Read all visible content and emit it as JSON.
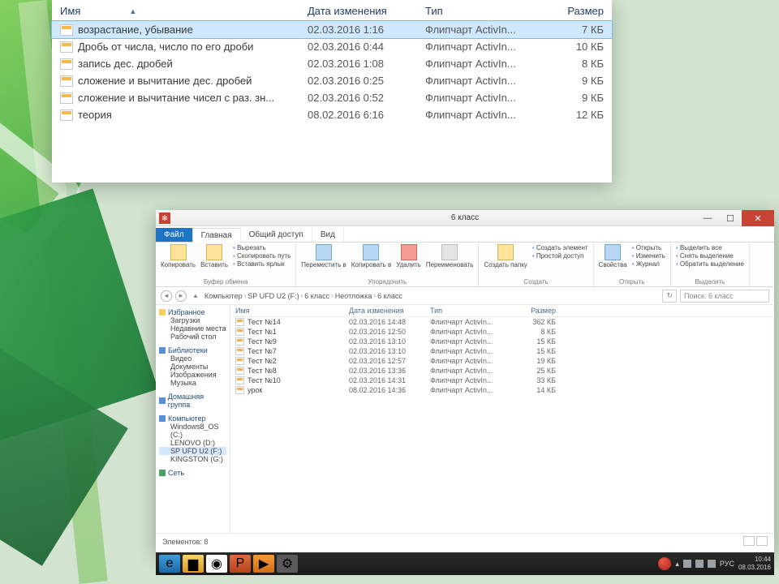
{
  "panel1": {
    "headers": {
      "name": "Имя",
      "date": "Дата изменения",
      "type": "Тип",
      "size": "Размер"
    },
    "rows": [
      {
        "name": "возрастание, убывание",
        "date": "02.03.2016 1:16",
        "type": "Флипчарт ActivIn...",
        "size": "7 КБ",
        "selected": true
      },
      {
        "name": "Дробь от числа, число по его дроби",
        "date": "02.03.2016 0:44",
        "type": "Флипчарт ActivIn...",
        "size": "10 КБ"
      },
      {
        "name": "запись дес. дробей",
        "date": "02.03.2016 1:08",
        "type": "Флипчарт ActivIn...",
        "size": "8 КБ"
      },
      {
        "name": "сложение и вычитание дес. дробей",
        "date": "02.03.2016 0:25",
        "type": "Флипчарт ActivIn...",
        "size": "9 КБ"
      },
      {
        "name": "сложение и вычитание чисел с раз. зн...",
        "date": "02.03.2016 0:52",
        "type": "Флипчарт ActivIn...",
        "size": "9 КБ"
      },
      {
        "name": "теория",
        "date": "08.02.2016 6:16",
        "type": "Флипчарт ActivIn...",
        "size": "12 КБ"
      }
    ]
  },
  "win": {
    "title": "6 класс",
    "tabs": {
      "file": "Файл",
      "home": "Главная",
      "share": "Общий доступ",
      "view": "Вид"
    },
    "ribbon": {
      "g1_big1": "Копировать",
      "g1_big2": "Вставить",
      "g1_s1": "Вырезать",
      "g1_s2": "Скопировать путь",
      "g1_s3": "Вставить ярлык",
      "g1_lab": "Буфер обмена",
      "g2_b1": "Переместить в",
      "g2_b2": "Копировать в",
      "g2_b3": "Удалить",
      "g2_b4": "Переименовать",
      "g2_lab": "Упорядочить",
      "g3_b1": "Создать папку",
      "g3_s1": "Создать элемент",
      "g3_s2": "Простой доступ",
      "g3_lab": "Создать",
      "g4_b1": "Свойства",
      "g4_s1": "Открыть",
      "g4_s2": "Изменить",
      "g4_s3": "Журнал",
      "g4_lab": "Открыть",
      "g5_s1": "Выделить все",
      "g5_s2": "Снять выделение",
      "g5_s3": "Обратить выделение",
      "g5_lab": "Выделить"
    },
    "breadcrumb": [
      "Компьютер",
      "SP UFD U2 (F:)",
      "6 класс",
      "Неотложка",
      "6 класс"
    ],
    "refresh": "↻",
    "search_placeholder": "Поиск: 6 класс",
    "tree": {
      "fav": "Избранное",
      "fav_items": [
        "Загрузки",
        "Недавние места",
        "Рабочий стол"
      ],
      "lib": "Библиотеки",
      "lib_items": [
        "Видео",
        "Документы",
        "Изображения",
        "Музыка"
      ],
      "home": "Домашняя группа",
      "comp": "Компьютер",
      "comp_items": [
        "Windows8_OS (C:)",
        "LENOVO (D:)",
        "SP UFD U2 (F:)",
        "KINGSTON (G:)"
      ],
      "net": "Сеть",
      "selected": "SP UFD U2 (F:)"
    },
    "fheaders": {
      "name": "Имя",
      "date": "Дата изменения",
      "type": "Тип",
      "size": "Размер"
    },
    "files": [
      {
        "n": "Тест №14",
        "d": "02.03.2016 14:48",
        "t": "Флипчарт ActivIn...",
        "s": "362 КБ"
      },
      {
        "n": "Тест №1",
        "d": "02.03.2016 12:50",
        "t": "Флипчарт ActivIn...",
        "s": "8 КБ"
      },
      {
        "n": "Тест №9",
        "d": "02.03.2016 13:10",
        "t": "Флипчарт ActivIn...",
        "s": "15 КБ"
      },
      {
        "n": "Тест №7",
        "d": "02.03.2016 13:10",
        "t": "Флипчарт ActivIn...",
        "s": "15 КБ"
      },
      {
        "n": "Тест №2",
        "d": "02.03.2016 12:57",
        "t": "Флипчарт ActivIn...",
        "s": "19 КБ"
      },
      {
        "n": "Тест №8",
        "d": "02.03.2016 13:36",
        "t": "Флипчарт ActivIn...",
        "s": "25 КБ"
      },
      {
        "n": "Тест №10",
        "d": "02.03.2016 14:31",
        "t": "Флипчарт ActivIn...",
        "s": "33 КБ"
      },
      {
        "n": "урок",
        "d": "08.02.2016 14:36",
        "t": "Флипчарт ActivIn...",
        "s": "14 КБ"
      }
    ],
    "status": "Элементов: 8"
  },
  "taskbar": {
    "lang": "РУС",
    "time": "10:44",
    "date": "08.03.2016"
  }
}
